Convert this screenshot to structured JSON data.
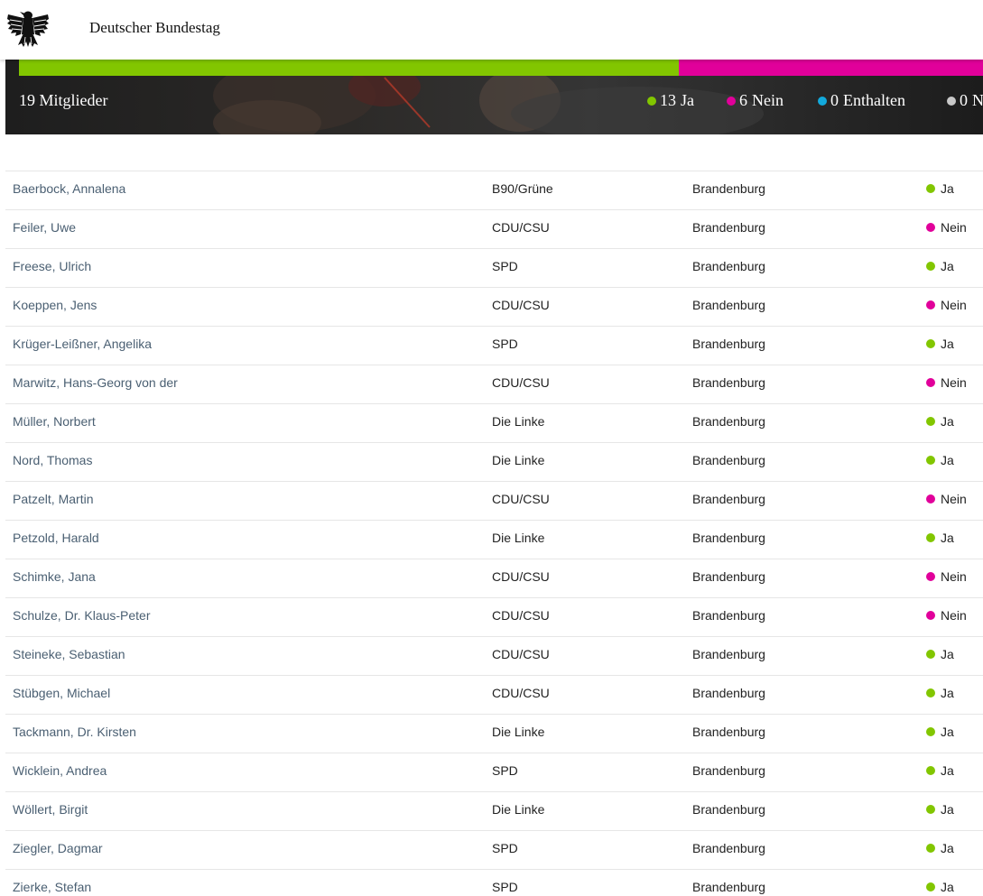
{
  "header": {
    "site_title": "Deutscher Bundestag",
    "logo_icon": "bundesadler-icon"
  },
  "summary": {
    "members_count": "19 Mitglieder",
    "colors": {
      "yes": "#82c600",
      "no": "#e1009a",
      "abstain": "#12a9dc",
      "absent": "#c8c8c8"
    },
    "legend": [
      {
        "key": "yes",
        "number": "13",
        "label": "Ja"
      },
      {
        "key": "no",
        "number": "6",
        "label": "Nein"
      },
      {
        "key": "abstain",
        "number": "0",
        "label": "Enthalten"
      },
      {
        "key": "absent",
        "number": "0",
        "label": "N"
      }
    ],
    "bar_fractions": {
      "yes": 0.684,
      "no": 0.316
    }
  },
  "members": [
    {
      "name": "Baerbock, Annalena",
      "party": "B90/Grüne",
      "state": "Brandenburg",
      "vote": "Ja",
      "vote_key": "yes"
    },
    {
      "name": "Feiler, Uwe",
      "party": "CDU/CSU",
      "state": "Brandenburg",
      "vote": "Nein",
      "vote_key": "no"
    },
    {
      "name": "Freese, Ulrich",
      "party": "SPD",
      "state": "Brandenburg",
      "vote": "Ja",
      "vote_key": "yes"
    },
    {
      "name": "Koeppen, Jens",
      "party": "CDU/CSU",
      "state": "Brandenburg",
      "vote": "Nein",
      "vote_key": "no"
    },
    {
      "name": "Krüger-Leißner, Angelika",
      "party": "SPD",
      "state": "Brandenburg",
      "vote": "Ja",
      "vote_key": "yes"
    },
    {
      "name": "Marwitz, Hans-Georg von der",
      "party": "CDU/CSU",
      "state": "Brandenburg",
      "vote": "Nein",
      "vote_key": "no"
    },
    {
      "name": "Müller, Norbert",
      "party": "Die Linke",
      "state": "Brandenburg",
      "vote": "Ja",
      "vote_key": "yes"
    },
    {
      "name": "Nord, Thomas",
      "party": "Die Linke",
      "state": "Brandenburg",
      "vote": "Ja",
      "vote_key": "yes"
    },
    {
      "name": "Patzelt, Martin",
      "party": "CDU/CSU",
      "state": "Brandenburg",
      "vote": "Nein",
      "vote_key": "no"
    },
    {
      "name": "Petzold, Harald",
      "party": "Die Linke",
      "state": "Brandenburg",
      "vote": "Ja",
      "vote_key": "yes"
    },
    {
      "name": "Schimke, Jana",
      "party": "CDU/CSU",
      "state": "Brandenburg",
      "vote": "Nein",
      "vote_key": "no"
    },
    {
      "name": "Schulze, Dr. Klaus-Peter",
      "party": "CDU/CSU",
      "state": "Brandenburg",
      "vote": "Nein",
      "vote_key": "no"
    },
    {
      "name": "Steineke, Sebastian",
      "party": "CDU/CSU",
      "state": "Brandenburg",
      "vote": "Ja",
      "vote_key": "yes"
    },
    {
      "name": "Stübgen, Michael",
      "party": "CDU/CSU",
      "state": "Brandenburg",
      "vote": "Ja",
      "vote_key": "yes"
    },
    {
      "name": "Tackmann, Dr. Kirsten",
      "party": "Die Linke",
      "state": "Brandenburg",
      "vote": "Ja",
      "vote_key": "yes"
    },
    {
      "name": "Wicklein, Andrea",
      "party": "SPD",
      "state": "Brandenburg",
      "vote": "Ja",
      "vote_key": "yes"
    },
    {
      "name": "Wöllert, Birgit",
      "party": "Die Linke",
      "state": "Brandenburg",
      "vote": "Ja",
      "vote_key": "yes"
    },
    {
      "name": "Ziegler, Dagmar",
      "party": "SPD",
      "state": "Brandenburg",
      "vote": "Ja",
      "vote_key": "yes"
    },
    {
      "name": "Zierke, Stefan",
      "party": "SPD",
      "state": "Brandenburg",
      "vote": "Ja",
      "vote_key": "yes"
    }
  ]
}
